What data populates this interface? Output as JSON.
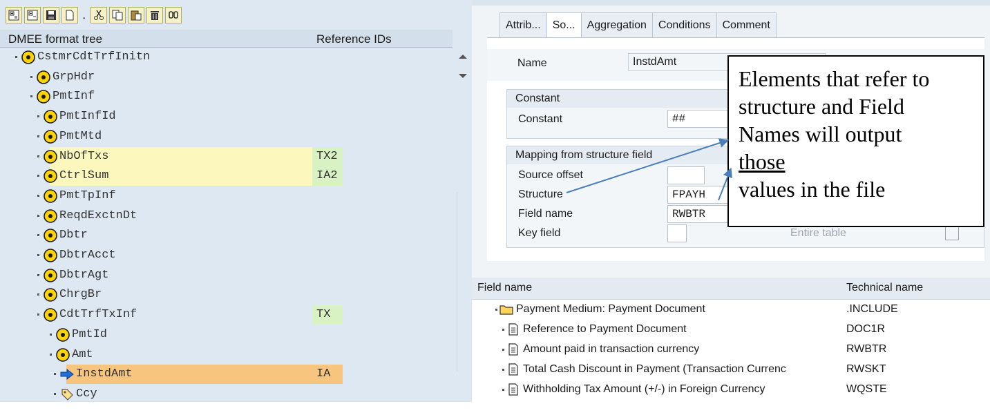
{
  "toolbar": {
    "icons": [
      "expand-icon",
      "collapse-icon",
      "save-icon",
      "new-icon",
      "cut-icon",
      "copy-icon",
      "paste-icon",
      "delete-icon",
      "find-icon"
    ]
  },
  "tree": {
    "col_name": "DMEE format tree",
    "col_ref": "Reference IDs",
    "nodes": [
      {
        "label": "CstmrCdtTrfInitn",
        "ref": "",
        "level": 0
      },
      {
        "label": "GrpHdr",
        "ref": "",
        "level": 1
      },
      {
        "label": "PmtInf",
        "ref": "",
        "level": 1
      },
      {
        "label": "PmtInfId",
        "ref": "",
        "level": 2
      },
      {
        "label": "PmtMtd",
        "ref": "",
        "level": 2
      },
      {
        "label": "NbOfTxs",
        "ref": "TX2",
        "level": 2
      },
      {
        "label": "CtrlSum",
        "ref": "IA2",
        "level": 2
      },
      {
        "label": "PmtTpInf",
        "ref": "",
        "level": 2
      },
      {
        "label": "ReqdExctnDt",
        "ref": "",
        "level": 2
      },
      {
        "label": "Dbtr",
        "ref": "",
        "level": 2
      },
      {
        "label": "DbtrAcct",
        "ref": "",
        "level": 2
      },
      {
        "label": "DbtrAgt",
        "ref": "",
        "level": 2
      },
      {
        "label": "ChrgBr",
        "ref": "",
        "level": 2
      },
      {
        "label": "CdtTrfTxInf",
        "ref": "TX",
        "level": 2
      },
      {
        "label": "PmtId",
        "ref": "",
        "level": 3
      },
      {
        "label": "Amt",
        "ref": "",
        "level": 3
      },
      {
        "label": "InstdAmt",
        "ref": "IA",
        "level": 4
      },
      {
        "label": "Ccy",
        "ref": "",
        "level": 4
      }
    ]
  },
  "tabs": [
    "Attrib...",
    "So...",
    "Aggregation",
    "Conditions",
    "Comment"
  ],
  "form": {
    "name_label": "Name",
    "name_value": "InstdAmt",
    "constant_group": "Constant",
    "constant_label": "Constant",
    "constant_value": "##",
    "mapping_group": "Mapping from structure field",
    "source_offset_label": "Source offset",
    "structure_label": "Structure",
    "structure_value": "FPAYH",
    "field_name_label": "Field name",
    "field_name_value": "RWBTR",
    "key_field_label": "Key field",
    "entire_table_label": "Entire table"
  },
  "field_table": {
    "col_field": "Field name",
    "col_tech": "Technical name",
    "rows": [
      {
        "name": "Payment Medium: Payment Document",
        "tech": ".INCLUDE",
        "icon": "folder-icon"
      },
      {
        "name": "Reference to Payment Document",
        "tech": "DOC1R",
        "icon": "document-icon"
      },
      {
        "name": "Amount paid in transaction currency",
        "tech": "RWBTR",
        "icon": "document-icon"
      },
      {
        "name": "Total Cash Discount in Payment (Transaction Currenc",
        "tech": "RWSKT",
        "icon": "document-icon"
      },
      {
        "name": "Withholding Tax Amount (+/-) in Foreign Currency",
        "tech": "WQSTE",
        "icon": "document-icon"
      }
    ]
  },
  "callout": {
    "line1": "Elements that refer to",
    "line2": "structure and Field",
    "line3": "Names will output",
    "line4": "those",
    "line5": "values in the file"
  },
  "colors": {
    "tree_bg": "#dde8f3",
    "highlight_yellow": "#fbf7bd",
    "highlight_green": "#d9f2c3",
    "selected_orange": "#f7c57d",
    "node_icon_yellow": "#ffd400",
    "arrow_blue": "#4a7ebb"
  }
}
